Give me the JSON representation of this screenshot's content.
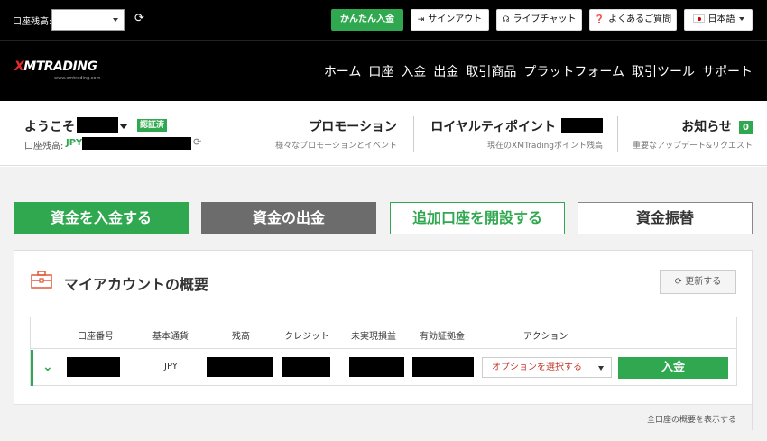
{
  "topbar": {
    "balance_label": "口座残高:",
    "quick_deposit": "かんたん入金",
    "signout": "サインアウト",
    "live_chat": "ライブチャット",
    "faq": "よくあるご質問",
    "language": "日本語"
  },
  "brand": {
    "logo_mark": "X",
    "logo_text": "MTRADING",
    "logo_sub": "www.xmtrading.com"
  },
  "nav": [
    "ホーム",
    "口座",
    "入金",
    "出金",
    "取引商品",
    "プラットフォーム",
    "取引ツール",
    "サポート"
  ],
  "welcome": {
    "greeting": "ようこそ",
    "verified": "認証済",
    "balance_label": "口座残高:",
    "currency": "JPY"
  },
  "promotion": {
    "title": "プロモーション",
    "subtitle": "様々なプロモーションとイベント"
  },
  "loyalty": {
    "title": "ロイヤルティポイント",
    "subtitle": "現在のXMTradingポイント残高"
  },
  "news": {
    "title": "お知らせ",
    "count": "0",
    "subtitle": "重要なアップデート&リクエスト"
  },
  "actions": {
    "deposit": "資金を入金する",
    "withdraw": "資金の出金",
    "open_account": "追加口座を開設する",
    "transfer": "資金振替"
  },
  "overview": {
    "title": "マイアカウントの概要",
    "refresh": "更新する",
    "columns": [
      "口座番号",
      "基本通貨",
      "残高",
      "クレジット",
      "未実現損益",
      "有効証拠金",
      "アクション"
    ],
    "row": {
      "currency": "JPY",
      "option_select": "オプションを選択する",
      "deposit": "入金"
    },
    "footer_link": "全口座の概要を表示する"
  }
}
